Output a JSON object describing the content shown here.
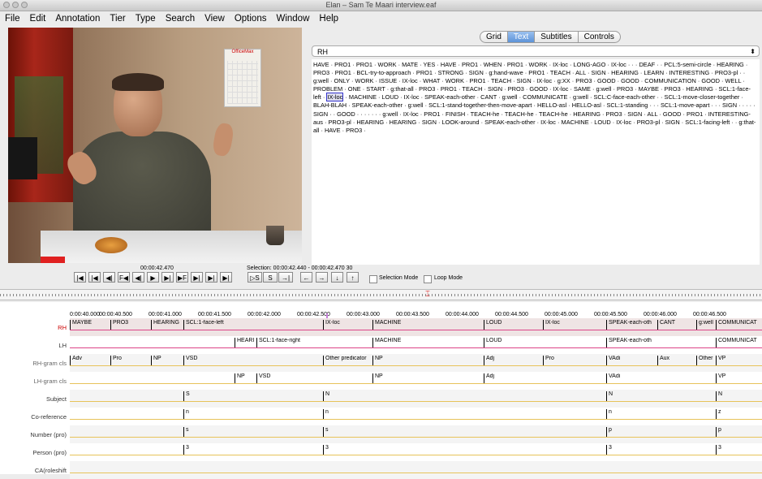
{
  "window": {
    "title": "Elan – Sam Te Maari interview.eaf"
  },
  "menu": [
    "File",
    "Edit",
    "Annotation",
    "Tier",
    "Type",
    "Search",
    "View",
    "Options",
    "Window",
    "Help"
  ],
  "video": {
    "calendar_label": "OfficeMax"
  },
  "view_tabs": [
    "Grid",
    "Text",
    "Subtitles",
    "Controls"
  ],
  "selected_tab": "Text",
  "text_panel": {
    "tier": "RH",
    "before": "HAVE · PRO1 · PRO1 · WORK · MATE · YES · HAVE · PRO1 · WHEN · PRO1 · WORK · IX-loc · LONG-AGO · IX-loc · · · DEAF · · PCL:5-semi-circle · HEARING · PRO3 · PRO1 · BCL-try-to-approach · PRO1 · STRONG · SIGN · g:hand-wave · PRO1 · TEACH · ALL · SIGN · HEARING · LEARN · INTERESTING · PRO3-pl · · g:well · ONLY · WORK · ISSUE · IX-loc · WHAT · WORK · PRO1 · TEACH · SIGN · IX-loc · g:XX · PRO3 · GOOD · GOOD · COMMUNICATION · GOOD · WELL · PROBLEM · ONE · START · g:that-all · PRO3 · PRO1 · TEACH · SIGN · PRO3 · GOOD · IX-loc · SAME · g:well · PRO3 · MAYBE · PRO3 · HEARING · SCL:1-face-left · ",
    "highlight": "IX-loc",
    "after": " · MACHINE · LOUD · IX-loc · SPEAK-each-other · CANT · g:well · COMMUNICATE · g:well · SCL:C-face-each-other · · SCL:1-move-closer-together · BLAH-BLAH · SPEAK-each-other · g:well · SCL:1-stand-together-then-move-apart · HELLO-asl · HELLO-asl · SCL:1-standing · · · SCL:1-move-apart · · · SIGN · · · · · SIGN · · GOOD · · · · · · · g:well · IX-loc · PRO1 · FINISH · TEACH-he · TEACH-he · TEACH-he · HEARING · PRO3 · SIGN · ALL · GOOD · PRO1 · INTERESTING-aus · PRO3-pl · HEARING · HEARING · SIGN · LOOK-around · SPEAK-each-other · IX-loc · MACHINE · LOUD · IX-loc · PRO3-pl · SIGN · SCL:1-facing-left · · g:that-all · HAVE · PRO3 ·"
  },
  "player": {
    "current_time": "00:00:42.470",
    "selection": "Selection: 00:00:42.440 - 00:00:42.470  30",
    "buttons": [
      "|◀",
      "|◀",
      "◀|",
      "F◀",
      "◀|",
      "▶",
      "▶|",
      "▶F",
      "▶|",
      "▶|",
      "▶|"
    ],
    "sel_buttons": [
      "▷S",
      "S",
      "→|"
    ],
    "nav_buttons": [
      "←",
      "→",
      "↓",
      "↑"
    ],
    "selection_mode": "Selection Mode",
    "loop_mode": "Loop Mode"
  },
  "timeline": {
    "ticks": [
      "0:00:40.000",
      "00:00:40.500",
      "00:00:41.000",
      "00:00:41.500",
      "00:00:42.000",
      "00:00:42.500",
      "00:00:43.000",
      "00:00:43.500",
      "00:00:44.000",
      "00:00:44.500",
      "00:00:45.000",
      "00:00:45.500",
      "00:00:46.000",
      "00:00:46.500"
    ],
    "tiers": [
      {
        "name": "RH",
        "segs": [
          [
            "MAYBE",
            0,
            50
          ],
          [
            "PRO3",
            50,
            100
          ],
          [
            "HEARING",
            100,
            140
          ],
          [
            "SCL:1-face-left",
            140,
            312
          ],
          [
            "IX-loc",
            312,
            373
          ],
          [
            "MACHINE",
            373,
            510
          ],
          [
            "LOUD",
            510,
            583
          ],
          [
            "IX-loc",
            583,
            661
          ],
          [
            "SPEAK-each-oth",
            661,
            724
          ],
          [
            "CANT",
            724,
            772
          ],
          [
            "g:well",
            772,
            796
          ],
          [
            "COMMUNICAT",
            796,
            853
          ]
        ]
      },
      {
        "name": "LH",
        "segs": [
          [
            "HEARI",
            203,
            230
          ],
          [
            "SCL:1-face-right",
            230,
            312
          ],
          [
            "MACHINE",
            373,
            510
          ],
          [
            "LOUD",
            510,
            583
          ],
          [
            "SPEAK-each-oth",
            661,
            724
          ],
          [
            "COMMUNICAT",
            796,
            853
          ]
        ]
      },
      {
        "name": "RH-gram cls",
        "segs": [
          [
            "Adv",
            0,
            50
          ],
          [
            "Pro",
            50,
            100
          ],
          [
            "NP",
            100,
            140
          ],
          [
            "VSD",
            140,
            312
          ],
          [
            "Other predicator",
            312,
            373
          ],
          [
            "NP",
            373,
            510
          ],
          [
            "Adj",
            510,
            583
          ],
          [
            "Pro",
            583,
            661
          ],
          [
            "VAdi",
            661,
            724
          ],
          [
            "Aux",
            724,
            772
          ],
          [
            "Other",
            772,
            796
          ],
          [
            "VP",
            796,
            853
          ]
        ]
      },
      {
        "name": "LH-gram cls",
        "segs": [
          [
            "NP",
            203,
            230
          ],
          [
            "VSD",
            230,
            312
          ],
          [
            "NP",
            373,
            510
          ],
          [
            "Adj",
            510,
            583
          ],
          [
            "VAdi",
            661,
            724
          ],
          [
            "VP",
            796,
            853
          ]
        ]
      },
      {
        "name": "Subject",
        "segs": [
          [
            "S",
            140,
            312
          ],
          [
            "N",
            312,
            373
          ],
          [
            "N",
            661,
            724
          ],
          [
            "N",
            796,
            853
          ]
        ]
      },
      {
        "name": "Co-reference",
        "segs": [
          [
            "n",
            140,
            312
          ],
          [
            "n",
            312,
            373
          ],
          [
            "n",
            661,
            724
          ],
          [
            "z",
            796,
            853
          ]
        ]
      },
      {
        "name": "Number (pro)",
        "segs": [
          [
            "s",
            140,
            312
          ],
          [
            "s",
            312,
            373
          ],
          [
            "p",
            661,
            724
          ],
          [
            "p",
            796,
            853
          ]
        ]
      },
      {
        "name": "Person (pro)",
        "segs": [
          [
            "3",
            140,
            312
          ],
          [
            "3",
            312,
            373
          ],
          [
            "3",
            661,
            724
          ],
          [
            "3",
            796,
            853
          ]
        ]
      },
      {
        "name": "CA(roleshift",
        "segs": []
      }
    ]
  }
}
